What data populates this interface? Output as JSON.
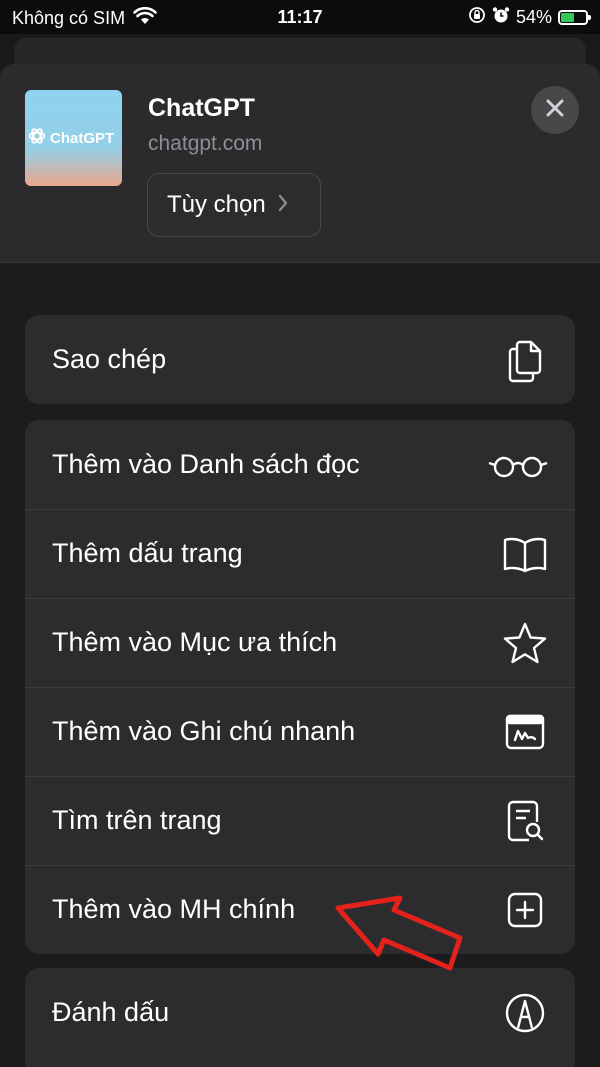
{
  "status_bar": {
    "carrier": "Không có SIM",
    "time": "11:17",
    "battery_percent": "54%",
    "battery_level": 0.54
  },
  "app": {
    "title": "ChatGPT",
    "url": "chatgpt.com",
    "thumbnail_text": "ChatGPT",
    "options_label": "Tùy chọn"
  },
  "menu": {
    "group1": [
      {
        "label": "Sao chép",
        "icon": "copy-icon"
      }
    ],
    "group2": [
      {
        "label": "Thêm vào Danh sách đọc",
        "icon": "glasses-icon"
      },
      {
        "label": "Thêm dấu trang",
        "icon": "book-icon"
      },
      {
        "label": "Thêm vào Mục ưa thích",
        "icon": "star-icon"
      },
      {
        "label": "Thêm vào Ghi chú nhanh",
        "icon": "quick-note-icon"
      },
      {
        "label": "Tìm trên trang",
        "icon": "find-in-page-icon"
      },
      {
        "label": "Thêm vào MH chính",
        "icon": "add-square-icon"
      }
    ],
    "group3": [
      {
        "label": "Đánh dấu",
        "icon": "markup-icon"
      }
    ]
  },
  "colors": {
    "sheet_bg": "#1c1c1e",
    "row_bg": "#2c2c2e",
    "annotation_arrow": "#e3221b",
    "battery": "#34c759"
  }
}
